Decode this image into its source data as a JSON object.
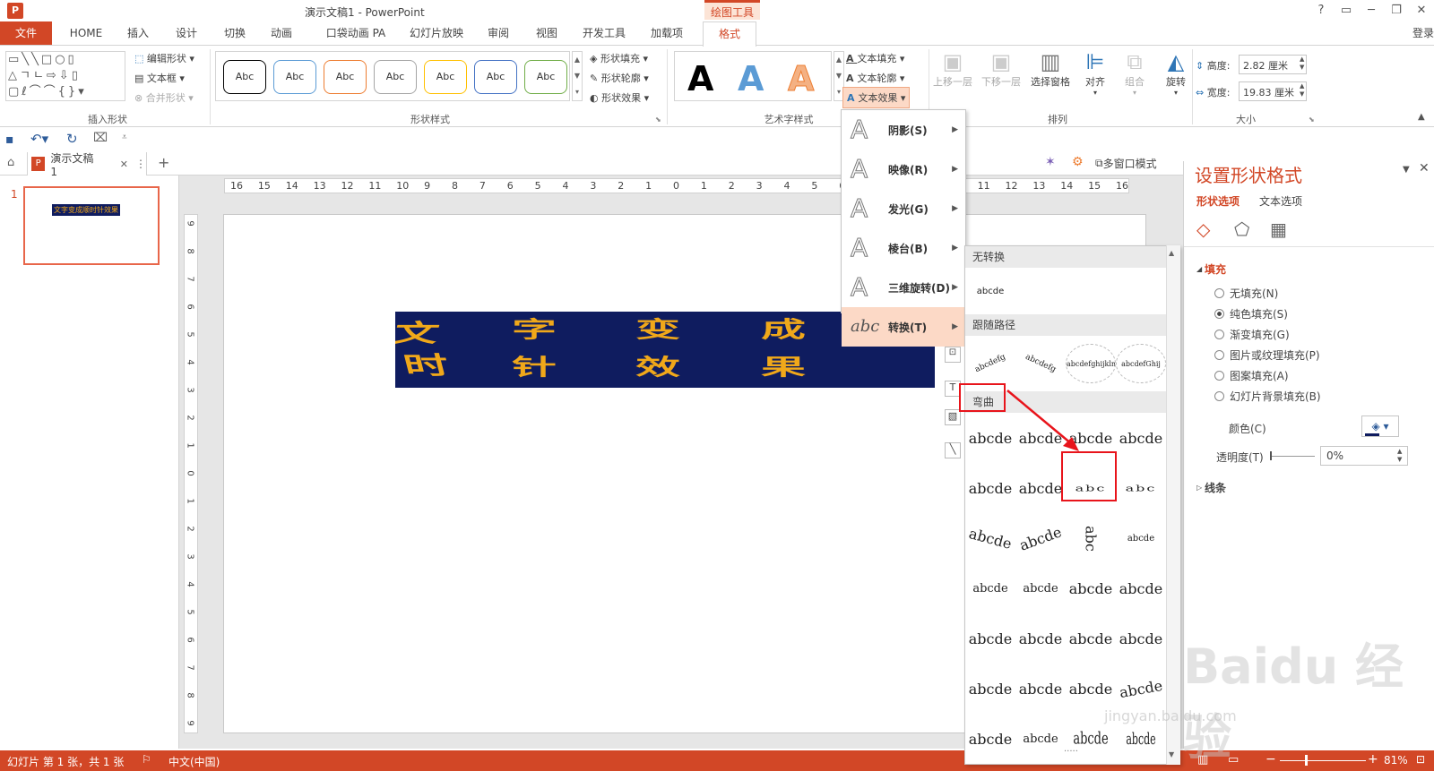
{
  "titlebar": {
    "title": "演示文稿1 - PowerPoint",
    "context_tab": "绘图工具",
    "help": "?",
    "login": "登录"
  },
  "tabs": [
    "文件",
    "HOME",
    "插入",
    "设计",
    "切换",
    "动画",
    "口袋动画 PA",
    "幻灯片放映",
    "审阅",
    "视图",
    "开发工具",
    "加载项",
    "格式"
  ],
  "ribbon": {
    "insert_shapes": {
      "label": "插入形状",
      "edit_shape": "编辑形状",
      "text_box": "文本框",
      "merge_shapes": "合并形状"
    },
    "shape_styles": {
      "label": "形状样式",
      "swatches": [
        {
          "text": "Abc",
          "color": "#000000"
        },
        {
          "text": "Abc",
          "color": "#5b9bd5"
        },
        {
          "text": "Abc",
          "color": "#ed7d31"
        },
        {
          "text": "Abc",
          "color": "#a5a5a5"
        },
        {
          "text": "Abc",
          "color": "#ffc000"
        },
        {
          "text": "Abc",
          "color": "#4472c4"
        },
        {
          "text": "Abc",
          "color": "#70ad47"
        }
      ],
      "fill": "形状填充",
      "outline": "形状轮廓",
      "effects": "形状效果"
    },
    "wordart": {
      "label": "艺术字样式",
      "text_fill": "文本填充",
      "text_outline": "文本轮廓",
      "text_effects": "文本效果"
    },
    "arrange": {
      "label": "排列",
      "bring_forward": "上移一层",
      "send_backward": "下移一层",
      "selection_pane": "选择窗格",
      "align": "对齐",
      "group": "组合",
      "rotate": "旋转"
    },
    "size": {
      "label": "大小",
      "height_label": "高度:",
      "height_value": "2.82 厘米",
      "width_label": "宽度:",
      "width_value": "19.83 厘米"
    }
  },
  "doc_tab": {
    "name": "演示文稿1",
    "multi_window": "多窗口模式"
  },
  "slide_thumb": {
    "number": "1",
    "text": "文字变成顺时针效果"
  },
  "slide_text": {
    "line1": [
      "文",
      "字",
      "变",
      "成",
      "顺"
    ],
    "line2": [
      "时",
      "针",
      "效",
      "果"
    ]
  },
  "hruler_labels": [
    "16",
    "15",
    "14",
    "13",
    "12",
    "11",
    "10",
    "9",
    "8",
    "7",
    "6",
    "5",
    "4",
    "3",
    "2",
    "1",
    "0",
    "1",
    "2",
    "3",
    "4",
    "5",
    "6",
    "7",
    "8",
    "9",
    "10",
    "11",
    "12",
    "13",
    "14",
    "15",
    "16"
  ],
  "vruler_labels": [
    "9",
    "8",
    "7",
    "6",
    "5",
    "4",
    "3",
    "2",
    "1",
    "0",
    "1",
    "2",
    "3",
    "4",
    "5",
    "6",
    "7",
    "8",
    "9"
  ],
  "text_effects_menu": [
    {
      "icon": "A",
      "label": "阴影(S)"
    },
    {
      "icon": "A",
      "label": "映像(R)"
    },
    {
      "icon": "A",
      "label": "发光(G)"
    },
    {
      "icon": "A",
      "label": "棱台(B)"
    },
    {
      "icon": "A",
      "label": "三维旋转(D)"
    },
    {
      "icon": "abc",
      "label": "转换(T)"
    }
  ],
  "transform_gallery": {
    "no_transform": "无转换",
    "no_transform_sample": "abcde",
    "follow_path": "跟随路径",
    "follow_path_samples": [
      "abcdefg",
      "abcdefg",
      "abcdefghijklm",
      "abcdefGhij"
    ],
    "warp": "弯曲",
    "rows": [
      [
        "abcde",
        "abcde",
        "abcde",
        "abcde"
      ],
      [
        "abcde",
        "abcde",
        "abc",
        "abc"
      ],
      [
        "abcde",
        "abcde",
        "abc",
        "abcde"
      ],
      [
        "abcde",
        "abcde",
        "abcde",
        "abcde"
      ],
      [
        "abcde",
        "abcde",
        "abcde",
        "abcde"
      ],
      [
        "abcde",
        "abcde",
        "abcde",
        "abcde"
      ],
      [
        "abcde",
        "abcde",
        "abcde",
        "abcde"
      ]
    ],
    "more": "....."
  },
  "format_pane": {
    "title": "设置形状格式",
    "tab_shape": "形状选项",
    "tab_text": "文本选项",
    "fill_section": "填充",
    "options": [
      "无填充(N)",
      "纯色填充(S)",
      "渐变填充(G)",
      "图片或纹理填充(P)",
      "图案填充(A)",
      "幻灯片背景填充(B)"
    ],
    "selected_option": 1,
    "color_label": "颜色(C)",
    "transparency_label": "透明度(T)",
    "transparency_value": "0%",
    "line_section": "线条"
  },
  "statusbar": {
    "slide_info": "幻灯片 第 1 张，共 1 张",
    "language": "中文(中国)",
    "zoom": "81%"
  },
  "watermark": {
    "text": "Baidu 经验",
    "url": "jingyan.baidu.com"
  }
}
